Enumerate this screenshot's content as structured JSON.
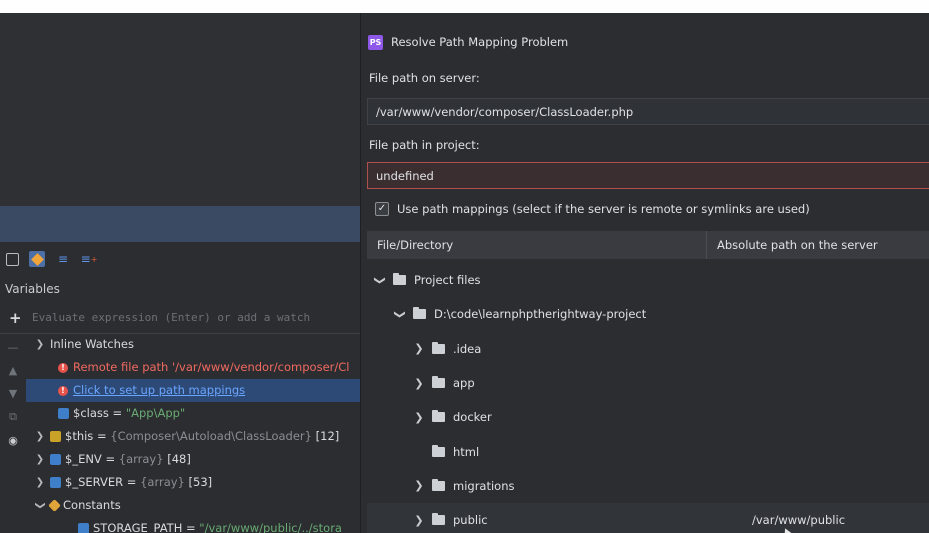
{
  "left_panel": {
    "toolbar_icons": [
      "table-view-icon",
      "watch-toggle-icon",
      "list-icon",
      "add-list-icon"
    ],
    "variables_title": "Variables",
    "evaluate_placeholder": "Evaluate expression (Enter) or add a watch",
    "tree": [
      {
        "label": "Inline Watches",
        "kind": "group",
        "expandable": true
      },
      {
        "label": "Remote file path '/var/www/vendor/composer/Cl",
        "kind": "error"
      },
      {
        "label": "Click to set up path mappings",
        "kind": "link",
        "selected": true
      },
      {
        "name": "$class",
        "eq": " = ",
        "value": "\"App\\App\"",
        "kind": "var"
      },
      {
        "name": "$this",
        "eq": " = ",
        "value": "{Composer\\Autoload\\ClassLoader}",
        "count": " [12]",
        "kind": "obj",
        "expandable": true
      },
      {
        "name": "$_ENV",
        "eq": " = ",
        "value": "{array}",
        "count": " [48]",
        "kind": "arr",
        "expandable": true
      },
      {
        "name": "$_SERVER",
        "eq": " = ",
        "value": "{array}",
        "count": " [53]",
        "kind": "arr",
        "expandable": true
      },
      {
        "label": "Constants",
        "kind": "const",
        "expanded": true
      },
      {
        "name": "STORAGE_PATH",
        "eq": " = ",
        "value": "\"/var/www/public/../stora",
        "kind": "var",
        "indent": true
      }
    ]
  },
  "dialog": {
    "title": "Resolve Path Mapping Problem",
    "server_label": "File path on server:",
    "server_value": "/var/www/vendor/composer/ClassLoader.php",
    "project_label": "File path in project:",
    "project_value": "undefined",
    "checkbox_label": "Use path mappings (select if the server is remote or symlinks are used)",
    "checkbox_checked": true,
    "columns": [
      "File/Directory",
      "Absolute path on the server"
    ],
    "rows": [
      {
        "label": "Project files",
        "level": 0,
        "chevron": "down",
        "server": ""
      },
      {
        "label": "D:\\code\\learnphptherightway-project",
        "level": 1,
        "chevron": "down",
        "server": ""
      },
      {
        "label": ".idea",
        "level": 2,
        "chevron": "right",
        "server": ""
      },
      {
        "label": "app",
        "level": 2,
        "chevron": "right",
        "server": ""
      },
      {
        "label": "docker",
        "level": 2,
        "chevron": "right",
        "server": ""
      },
      {
        "label": "html",
        "level": 2,
        "chevron": "none",
        "server": ""
      },
      {
        "label": "migrations",
        "level": 2,
        "chevron": "right",
        "server": ""
      },
      {
        "label": "public",
        "level": 2,
        "chevron": "right",
        "server": "/var/www/public"
      }
    ]
  },
  "colors": {
    "background": "#2b2d30",
    "error_red": "#f06a61",
    "link_blue": "#6aa5ff",
    "string_green": "#6aab73",
    "selection": "#2d4a77",
    "ps_logo": "#8e58e8"
  }
}
